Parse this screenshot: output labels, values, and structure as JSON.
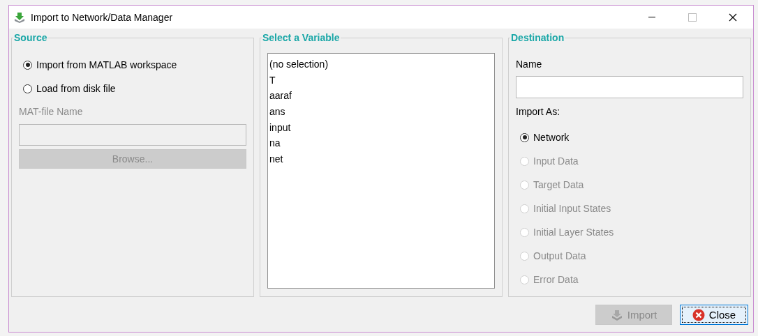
{
  "window": {
    "title": "Import to Network/Data Manager"
  },
  "source": {
    "title": "Source",
    "options": [
      {
        "label": "Import from MATLAB workspace",
        "selected": true,
        "disabled": false
      },
      {
        "label": "Load from disk file",
        "selected": false,
        "disabled": false
      }
    ],
    "mat_file_label": "MAT-file Name",
    "mat_file_disabled": true,
    "browse": {
      "label": "Browse...",
      "disabled": true
    }
  },
  "variables": {
    "title": "Select a Variable",
    "items": [
      {
        "label": "(no selection)",
        "selected": false
      },
      {
        "label": "T",
        "selected": false
      },
      {
        "label": "aaraf",
        "selected": false
      },
      {
        "label": "ans",
        "selected": false
      },
      {
        "label": "input",
        "selected": false
      },
      {
        "label": "na",
        "selected": false
      },
      {
        "label": "net",
        "selected": false
      }
    ]
  },
  "destination": {
    "title": "Destination",
    "name_label": "Name",
    "import_as_label": "Import As:",
    "options": [
      {
        "label": "Network",
        "selected": true,
        "disabled": false
      },
      {
        "label": "Input Data",
        "selected": false,
        "disabled": true
      },
      {
        "label": "Target Data",
        "selected": false,
        "disabled": true
      },
      {
        "label": "Initial Input States",
        "selected": false,
        "disabled": true
      },
      {
        "label": "Initial Layer States",
        "selected": false,
        "disabled": true
      },
      {
        "label": "Output Data",
        "selected": false,
        "disabled": true
      },
      {
        "label": "Error Data",
        "selected": false,
        "disabled": true
      }
    ]
  },
  "buttons": [
    {
      "label": "Import",
      "kind": "import",
      "disabled": true,
      "focused": false
    },
    {
      "label": "Close",
      "kind": "close",
      "disabled": false,
      "focused": true
    }
  ]
}
